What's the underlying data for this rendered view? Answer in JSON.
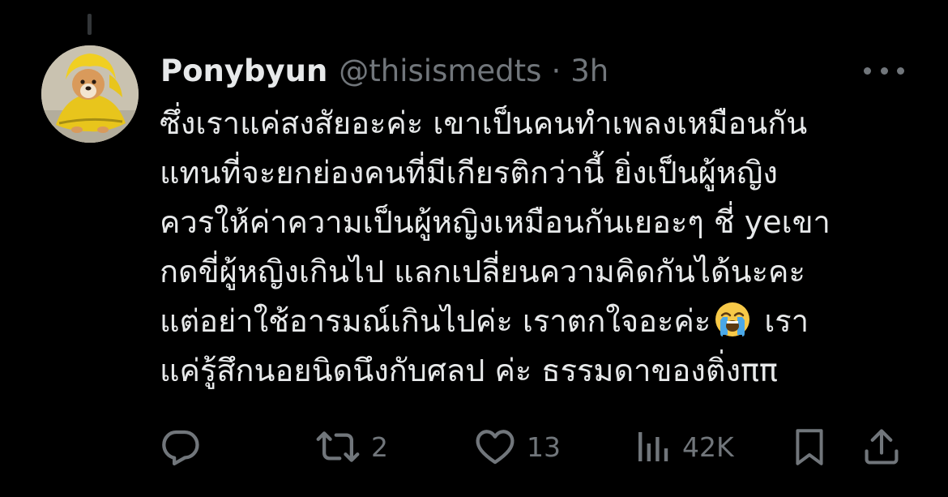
{
  "tweet": {
    "display_name": "Ponybyun",
    "handle": "@thisismedts",
    "separator": "·",
    "time": "3h",
    "body_lines": [
      "ซึ่งเราแค่สงสัยอะค่ะ เขาเป็นคนทำเพลงเหมือนกัน",
      "แทนที่จะยกย่องคนที่มีเกียรติกว่านี้ ยิ่งเป็นผู้หญิง",
      "ควรให้ค่าความเป็นผู้หญิงเหมือนกันเยอะๆ ชี่ yeเขา",
      "กดขี่ผู้หญิงเกินไป แลกเปลี่ยนความคิดกันได้นะคะ",
      "แต่อย่าใช้อารมณ์เกินไปค่ะ เราตกใจอะค่ะ",
      " เรา",
      "แค่รู้สึกนอยนิดนึงกับศลป ค่ะ ธรรมดาของติ่งππ"
    ],
    "avatar": "dog in yellow raincoat"
  },
  "actions": {
    "replies_icon": "reply-icon",
    "retweets_icon": "retweet-icon",
    "retweets": "2",
    "likes_icon": "heart-icon",
    "likes": "13",
    "views_icon": "views-icon",
    "views": "42K",
    "bookmark_icon": "bookmark-icon",
    "share_icon": "share-icon"
  },
  "colors": {
    "background": "#000000",
    "text": "#e7e9ea",
    "secondary": "#71767b",
    "emoji_face": "#f7c948",
    "emoji_tears": "#4aa8e8"
  }
}
